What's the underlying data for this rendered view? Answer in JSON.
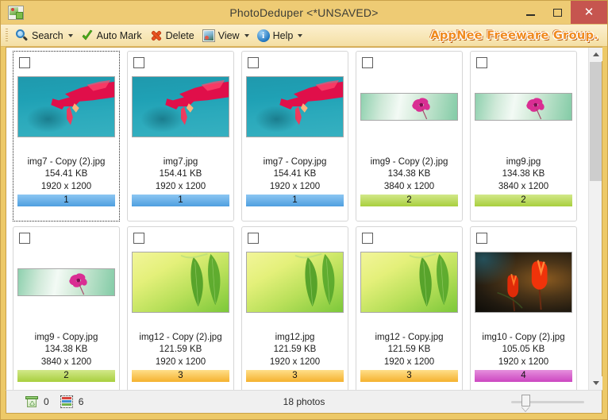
{
  "window": {
    "title": "PhotoDeduper <*UNSAVED>",
    "app_icon": "photo-app-icon",
    "minimize_label": "Minimize",
    "maximize_label": "Maximize",
    "close_label": "Close",
    "close_glyph": "✕"
  },
  "toolbar": {
    "items": [
      {
        "label": "Search",
        "icon": "magnifier-icon",
        "has_caret": true
      },
      {
        "label": "Auto Mark",
        "icon": "green-check-icon",
        "has_caret": false
      },
      {
        "label": "Delete",
        "icon": "red-x-icon",
        "has_caret": false
      },
      {
        "label": "View",
        "icon": "picture-icon",
        "has_caret": true
      },
      {
        "label": "Help",
        "icon": "info-icon",
        "has_caret": true
      }
    ],
    "brand": "AppNee Freeware Group.",
    "brand_color": "#f08a1e"
  },
  "grid": {
    "cards": [
      {
        "filename": "img7 - Copy (2).jpg",
        "size": "154.41 KB",
        "dimensions": "1920 x 1200",
        "group": "1",
        "group_color": "#4f9fe0",
        "checked": false,
        "focused": true,
        "art": "cactus",
        "thumb": "wide"
      },
      {
        "filename": "img7.jpg",
        "size": "154.41 KB",
        "dimensions": "1920 x 1200",
        "group": "1",
        "group_color": "#4f9fe0",
        "checked": false,
        "focused": false,
        "art": "cactus",
        "thumb": "wide"
      },
      {
        "filename": "img7 - Copy.jpg",
        "size": "154.41 KB",
        "dimensions": "1920 x 1200",
        "group": "1",
        "group_color": "#4f9fe0",
        "checked": false,
        "focused": false,
        "art": "cactus",
        "thumb": "wide"
      },
      {
        "filename": "img9 - Copy (2).jpg",
        "size": "134.38 KB",
        "dimensions": "3840 x 1200",
        "group": "2",
        "group_color": "#a8cf3e",
        "checked": false,
        "focused": false,
        "art": "pano",
        "thumb": "pano"
      },
      {
        "filename": "img9.jpg",
        "size": "134.38 KB",
        "dimensions": "3840 x 1200",
        "group": "2",
        "group_color": "#a8cf3e",
        "checked": false,
        "focused": false,
        "art": "pano",
        "thumb": "pano"
      },
      {
        "filename": "img9 - Copy.jpg",
        "size": "134.38 KB",
        "dimensions": "3840 x 1200",
        "group": "2",
        "group_color": "#a8cf3e",
        "checked": false,
        "focused": false,
        "art": "pano",
        "thumb": "pano"
      },
      {
        "filename": "img12 - Copy (2).jpg",
        "size": "121.59 KB",
        "dimensions": "1920 x 1200",
        "group": "3",
        "group_color": "#f5b12e",
        "checked": false,
        "focused": false,
        "art": "green",
        "thumb": "wide"
      },
      {
        "filename": "img12.jpg",
        "size": "121.59 KB",
        "dimensions": "1920 x 1200",
        "group": "3",
        "group_color": "#f5b12e",
        "checked": false,
        "focused": false,
        "art": "green",
        "thumb": "wide"
      },
      {
        "filename": "img12 - Copy.jpg",
        "size": "121.59 KB",
        "dimensions": "1920 x 1200",
        "group": "3",
        "group_color": "#f5b12e",
        "checked": false,
        "focused": false,
        "art": "green",
        "thumb": "wide"
      },
      {
        "filename": "img10 - Copy (2).jpg",
        "size": "105.05 KB",
        "dimensions": "1920 x 1200",
        "group": "4",
        "group_color": "#cc46c0",
        "checked": false,
        "focused": false,
        "art": "tulip",
        "thumb": "wide"
      }
    ]
  },
  "scrollbar": {
    "up_arrow": "chevron-up-icon",
    "down_arrow": "chevron-down-icon",
    "orientation": "vertical"
  },
  "statusbar": {
    "recycle_icon": "recycle-bin-icon",
    "deleted_count": "0",
    "marked_icon": "marked-items-icon",
    "marked_count": "6",
    "photos_text": "18 photos",
    "zoom_slider": "thumbnail-size-slider"
  }
}
